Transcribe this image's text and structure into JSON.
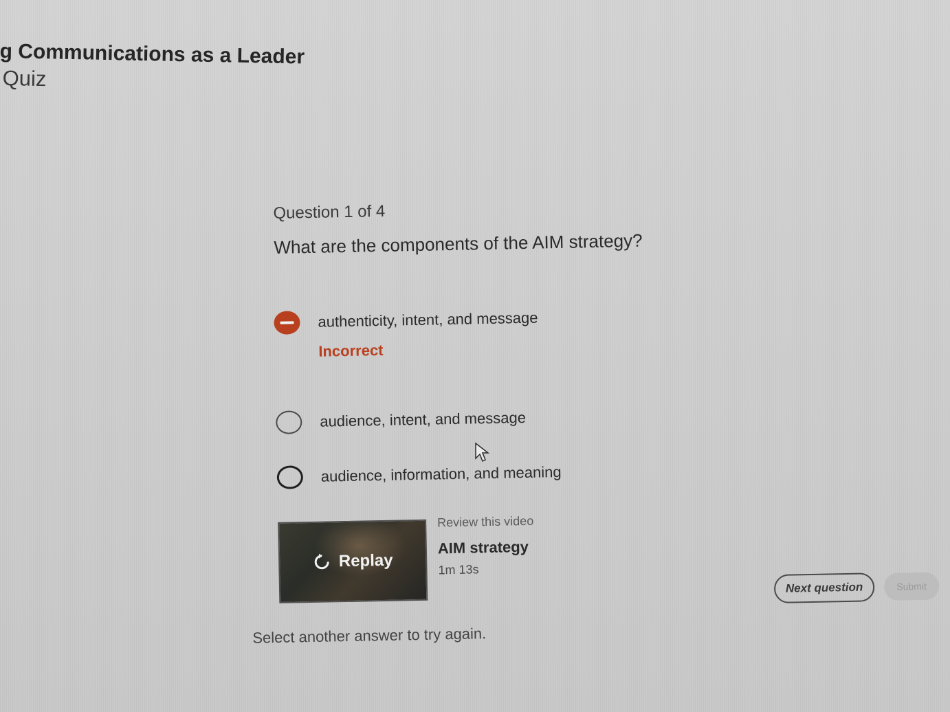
{
  "header": {
    "course_title": "g Communications as a Leader",
    "section_label": "Quiz"
  },
  "question": {
    "counter": "Question 1 of 4",
    "text": "What are the components of the AIM strategy?",
    "options": [
      {
        "label": "authenticity, intent, and message",
        "state": "incorrect"
      },
      {
        "label": "audience, intent, and message",
        "state": "unselected"
      },
      {
        "label": "audience, information, and meaning",
        "state": "unselected"
      }
    ],
    "feedback": "Incorrect"
  },
  "video": {
    "replay_label": "Replay",
    "review_label": "Review this video",
    "title": "AIM strategy",
    "duration": "1m 13s"
  },
  "actions": {
    "next_label": "Next question",
    "submit_label": "Submit"
  },
  "hint": "Select another answer to try again.",
  "colors": {
    "incorrect": "#b8401f",
    "background": "#cfcfcf"
  },
  "icons": {
    "incorrect": "minus-circle-icon",
    "replay": "replay-icon",
    "cursor": "mouse-cursor-icon"
  }
}
